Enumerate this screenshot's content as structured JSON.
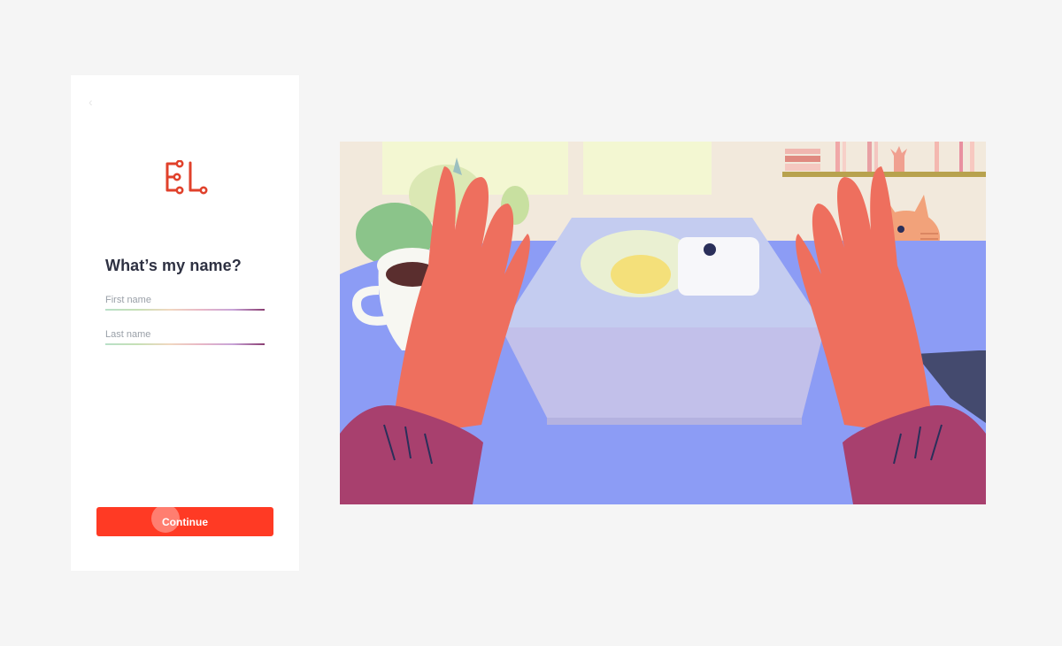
{
  "form": {
    "title": "What’s my name?",
    "first_name": {
      "value": "",
      "placeholder": "First name"
    },
    "last_name": {
      "value": "",
      "placeholder": "Last name"
    },
    "continue_label": "Continue"
  },
  "colors": {
    "accent": "#ff3a24",
    "logo": "#e0412b",
    "title_text": "#2e3142",
    "page_background": "#f5f5f5",
    "table": "#8c9cf5",
    "hands": "#ee6f5e",
    "sleeves": "#a8406e"
  },
  "icons": {
    "logo": "el-logo-icon",
    "back": "chevron-left-icon"
  }
}
